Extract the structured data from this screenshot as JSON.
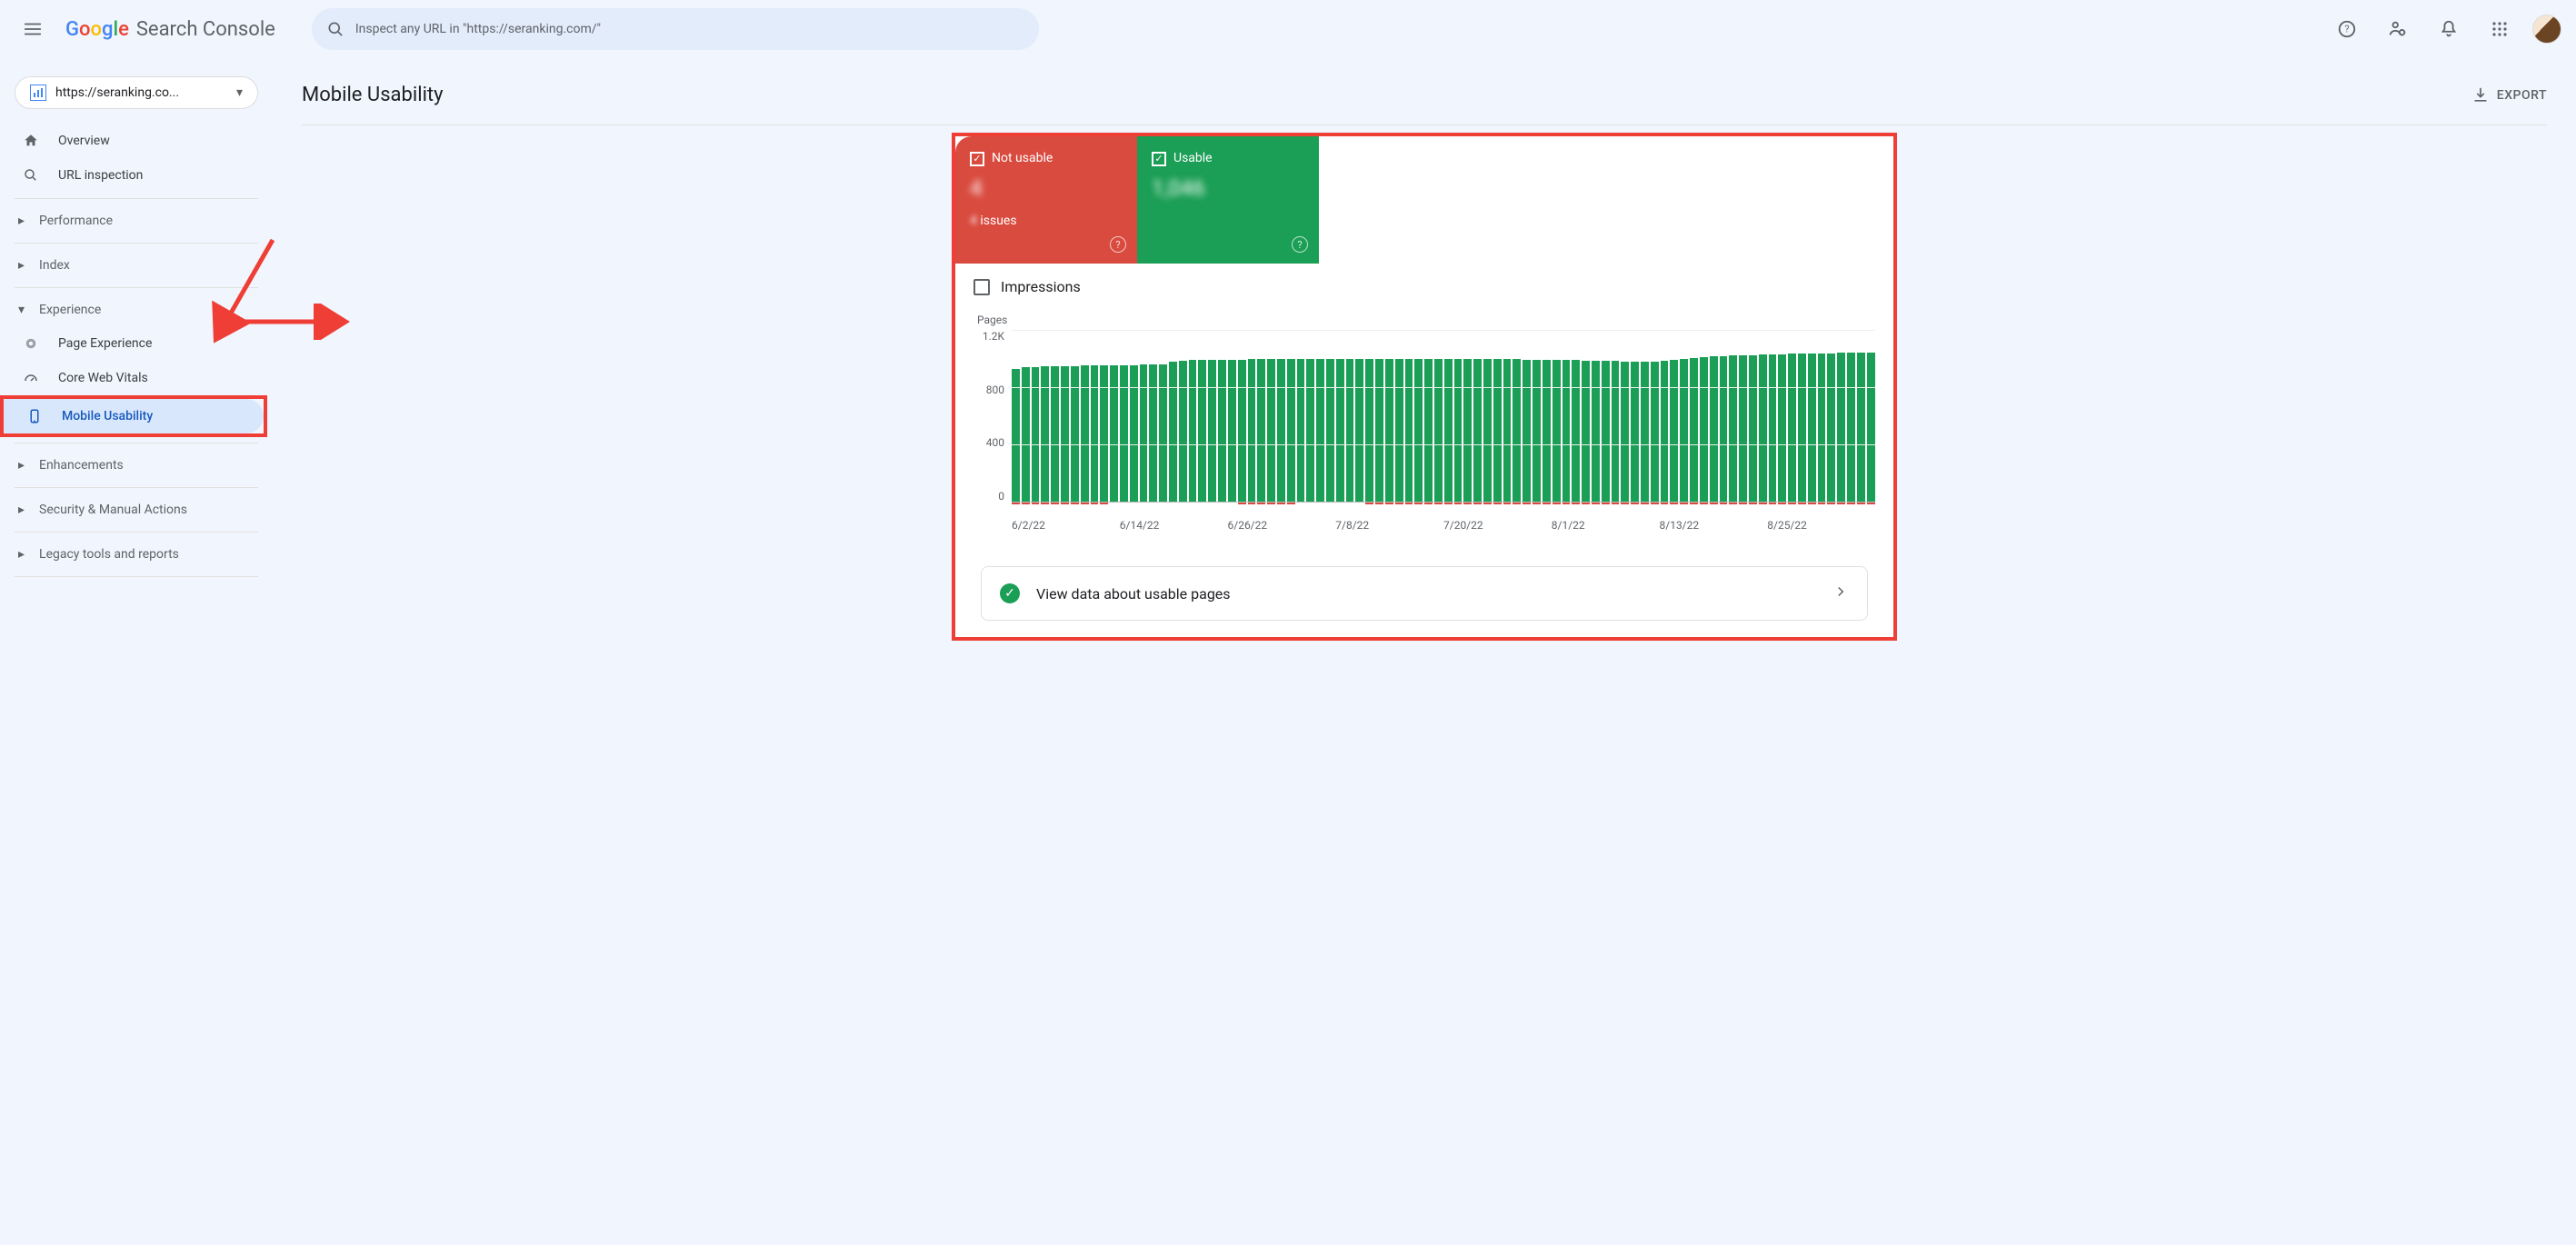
{
  "header": {
    "product_name": "Search Console",
    "search_placeholder": "Inspect any URL in \"https://seranking.com/\""
  },
  "property_selector": {
    "domain": "https://seranking.co..."
  },
  "sidebar": {
    "overview": "Overview",
    "url_inspection": "URL inspection",
    "performance": "Performance",
    "index": "Index",
    "experience": "Experience",
    "page_experience": "Page Experience",
    "core_web_vitals": "Core Web Vitals",
    "mobile_usability": "Mobile Usability",
    "enhancements": "Enhancements",
    "security": "Security & Manual Actions",
    "legacy": "Legacy tools and reports"
  },
  "page": {
    "title": "Mobile Usability",
    "export": "EXPORT"
  },
  "status": {
    "not_usable_label": "Not usable",
    "not_usable_value": "4",
    "not_usable_sub_prefix": "4 ",
    "not_usable_sub": "issues",
    "usable_label": "Usable",
    "usable_value": "1,046"
  },
  "impressions_label": "Impressions",
  "view_data_label": "View data about usable pages",
  "chart_data": {
    "type": "bar",
    "ylabel": "Pages",
    "yticks": [
      "1.2K",
      "800",
      "400",
      "0"
    ],
    "ylim": [
      0,
      1200
    ],
    "xticks": [
      "6/2/22",
      "6/14/22",
      "6/26/22",
      "7/8/22",
      "7/20/22",
      "8/1/22",
      "8/13/22",
      "8/25/22"
    ],
    "series": [
      {
        "name": "Usable",
        "color": "#1b9e55",
        "values": [
          930,
          940,
          940,
          945,
          945,
          948,
          948,
          950,
          950,
          952,
          952,
          954,
          955,
          958,
          958,
          960,
          980,
          985,
          988,
          988,
          990,
          990,
          992,
          992,
          994,
          994,
          995,
          995,
          996,
          996,
          997,
          997,
          998,
          998,
          999,
          999,
          1000,
          1000,
          1000,
          1000,
          1000,
          1000,
          1000,
          1000,
          1000,
          1000,
          998,
          998,
          996,
          996,
          994,
          994,
          992,
          992,
          990,
          990,
          988,
          988,
          986,
          985,
          983,
          982,
          980,
          980,
          978,
          978,
          985,
          990,
          998,
          1005,
          1010,
          1015,
          1018,
          1020,
          1022,
          1024,
          1026,
          1028,
          1030,
          1032,
          1034,
          1036,
          1038,
          1038,
          1040,
          1040,
          1042,
          1043
        ]
      },
      {
        "name": "Not usable",
        "color": "#d94b3f",
        "values": [
          3,
          3,
          3,
          3,
          3,
          3,
          3,
          3,
          4,
          4,
          2,
          2,
          2,
          2,
          2,
          2,
          2,
          2,
          2,
          2,
          2,
          2,
          2,
          3,
          3,
          4,
          4,
          3,
          3,
          2,
          2,
          2,
          2,
          2,
          2,
          2,
          3,
          3,
          3,
          3,
          3,
          3,
          3,
          3,
          3,
          3,
          3,
          3,
          3,
          3,
          3,
          3,
          3,
          3,
          3,
          4,
          5,
          6,
          5,
          4,
          3,
          3,
          3,
          3,
          3,
          3,
          3,
          3,
          3,
          3,
          3,
          3,
          3,
          3,
          3,
          3,
          3,
          3,
          3,
          3,
          3,
          3,
          3,
          3,
          3,
          3,
          3,
          3
        ]
      }
    ]
  }
}
